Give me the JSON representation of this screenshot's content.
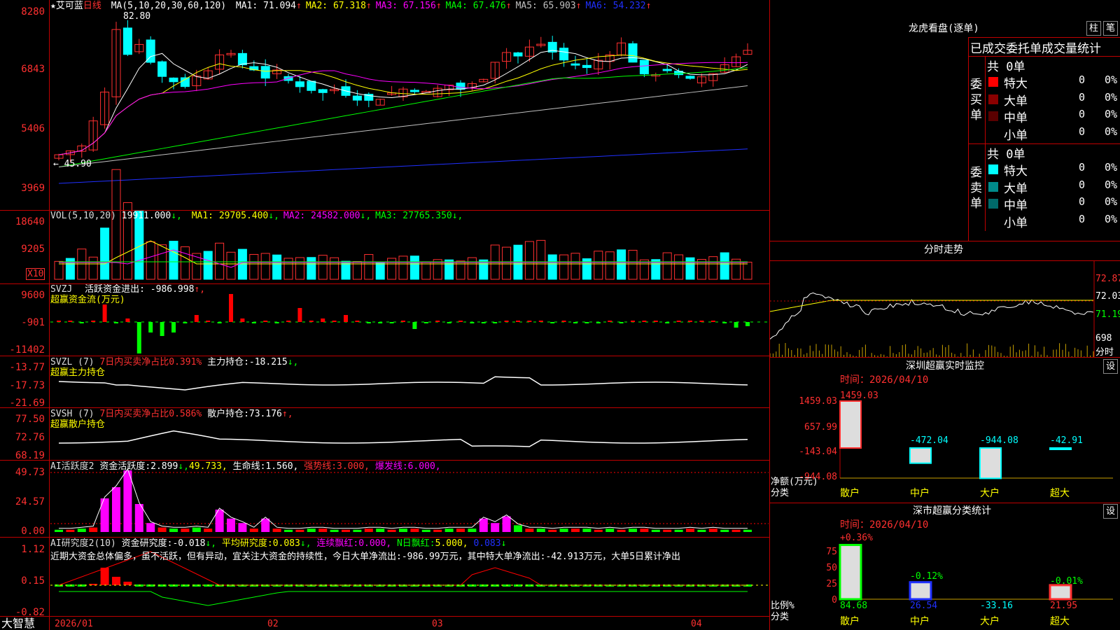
{
  "stock": {
    "star": "★",
    "name": "艾可蓝",
    "period": "日线"
  },
  "main_panel": {
    "y_ticks": [
      "8280",
      "6843",
      "5406",
      "3969"
    ],
    "ma_label": "MA(5,10,20,30,60,120)",
    "ma": [
      {
        "name": "MA1:",
        "value": "71.094",
        "arrow": "↑",
        "color": "#ffffff"
      },
      {
        "name": "MA2:",
        "value": "67.318",
        "arrow": "↑",
        "color": "#ffff00"
      },
      {
        "name": "MA3:",
        "value": "67.156",
        "arrow": "↑",
        "color": "#ff00ff"
      },
      {
        "name": "MA4:",
        "value": "67.476",
        "arrow": "↑",
        "color": "#00ff00"
      },
      {
        "name": "MA5:",
        "value": "65.903",
        "arrow": "↑",
        "color": "#c0c0c0"
      },
      {
        "name": "MA6:",
        "value": "54.232",
        "arrow": "↑",
        "color": "#2030ff"
      }
    ],
    "high_marker": "82.80",
    "low_marker": "← 45.90"
  },
  "vol_panel": {
    "y_ticks": [
      "18640",
      "9205"
    ],
    "scale_label": "X10",
    "header": "VOL(5,10,20)",
    "value": "19911.000",
    "ma": [
      {
        "name": "MA1:",
        "value": "29705.400",
        "arrow": "↓",
        "color": "#ffff00"
      },
      {
        "name": "MA2:",
        "value": "24582.000",
        "arrow": "↓",
        "color": "#ff00ff"
      },
      {
        "name": "MA3:",
        "value": "27765.350",
        "arrow": "↓",
        "color": "#00ff00"
      }
    ]
  },
  "svzj_panel": {
    "y_ticks": [
      "9600",
      "-901",
      "-11402"
    ],
    "header": "SVZJ",
    "label1": "活跃资金进出:",
    "value1": "-986.998",
    "arrow1": "↑,",
    "label2": "超赢资金流(万元)"
  },
  "svzl_panel": {
    "y_ticks": [
      "-13.77",
      "-17.73",
      "-21.69"
    ],
    "header": "SVZL (7)",
    "label_red": "7日内买卖净占比0.391%",
    "label": "主力持仓:",
    "value": "-18.215",
    "arrow": "↓,",
    "label2": "超赢主力持仓"
  },
  "svsh_panel": {
    "y_ticks": [
      "77.50",
      "72.76",
      "68.19"
    ],
    "header": "SVSH (7)",
    "label_red": "7日内买卖净占比0.586%",
    "label": "散户持仓:",
    "value": "73.176",
    "arrow": "↑,",
    "label2": "超赢散户持仓"
  },
  "ai_activity_panel": {
    "y_ticks": [
      "49.73",
      "24.57",
      "0.00"
    ],
    "header": "AI活跃度2",
    "label1": "资金活跃度:",
    "value1": "2.899",
    "arrow1": "↓,",
    "value2": "49.733,",
    "label3": "生命线:",
    "value3": "1.560,",
    "label4": "强势线:",
    "value4": "3.000,",
    "label5": "爆发线:",
    "value5": "6.000,"
  },
  "ai_research_panel": {
    "y_ticks": [
      "1.12",
      "0.15",
      "-0.82"
    ],
    "header": "AI研究度2(10)",
    "label1": "资金研究度:",
    "value1": "-0.018",
    "arrow1": "↓,",
    "label2": "平均研究度:",
    "value2": "0.083",
    "arrow2": "↓,",
    "label3": "连续飘红:",
    "value3": "0.000,",
    "label4": "N日飘红:",
    "value4": "5.000,",
    "value5": "0.083",
    "arrow5": "↓",
    "summary": "近期大资金总体偏多，虽不活跃，但有异动，宜关注大资金的持续性，今日大单净流出:-986.99万元，其中特大单净流出:-42.913万元，大单5日累计净出"
  },
  "x_axis": {
    "brand": "大智慧",
    "labels": [
      "2026/01",
      "02",
      "03",
      "04"
    ]
  },
  "dragon_tiger": {
    "title": "龙虎看盘(逐单)",
    "btn1": "柱",
    "btn2": "笔",
    "stats_title": "已成交委托单成交量统计",
    "buy": {
      "label": "委买单",
      "total": "共 0单",
      "rows": [
        {
          "name": "特大",
          "count": "0",
          "pct": "0%",
          "color": "#ff0000"
        },
        {
          "name": "大单",
          "count": "0",
          "pct": "0%",
          "color": "#8b0000"
        },
        {
          "name": "中单",
          "count": "0",
          "pct": "0%",
          "color": "#5a0000"
        },
        {
          "name": "小单",
          "count": "0",
          "pct": "0%",
          "color": ""
        }
      ]
    },
    "sell": {
      "label": "委卖单",
      "total": "共 0单",
      "rows": [
        {
          "name": "特大",
          "count": "0",
          "pct": "0%",
          "color": "#00ffff"
        },
        {
          "name": "大单",
          "count": "0",
          "pct": "0%",
          "color": "#008b8b"
        },
        {
          "name": "中单",
          "count": "0",
          "pct": "0%",
          "color": "#006a6a"
        },
        {
          "name": "小单",
          "count": "0",
          "pct": "0%",
          "color": ""
        }
      ]
    }
  },
  "intraday": {
    "title": "分时走势",
    "right_ticks": [
      "72.87",
      "72.03",
      "71.19",
      "698"
    ],
    "fen_shi": "分时"
  },
  "sz_monitor": {
    "title": "深圳超赢实时监控",
    "btn": "设",
    "time": "时间：2026/04/10",
    "y_ticks": [
      "1459.03",
      "657.99",
      "-143.04",
      "-944.08"
    ],
    "y_unit": "净额(万元)",
    "x_unit": "分类",
    "categories": [
      "散户",
      "中户",
      "大户",
      "超大"
    ],
    "values": [
      "1459.03",
      "-472.04",
      "-944.08",
      "-42.91"
    ]
  },
  "sz_class": {
    "title": "深市超赢分类统计",
    "btn": "设",
    "time": "时间：2026/04/10",
    "y_ticks": [
      "75",
      "50",
      "25",
      "0"
    ],
    "y_unit": "比例%",
    "x_unit": "分类",
    "categories": [
      "散户",
      "中户",
      "大户",
      "超大"
    ],
    "top_labels": [
      "+0.36%",
      "-0.12%",
      "",
      "-0.01%"
    ],
    "values": [
      "84.68",
      "26.54",
      "-33.16",
      "21.95"
    ]
  }
}
